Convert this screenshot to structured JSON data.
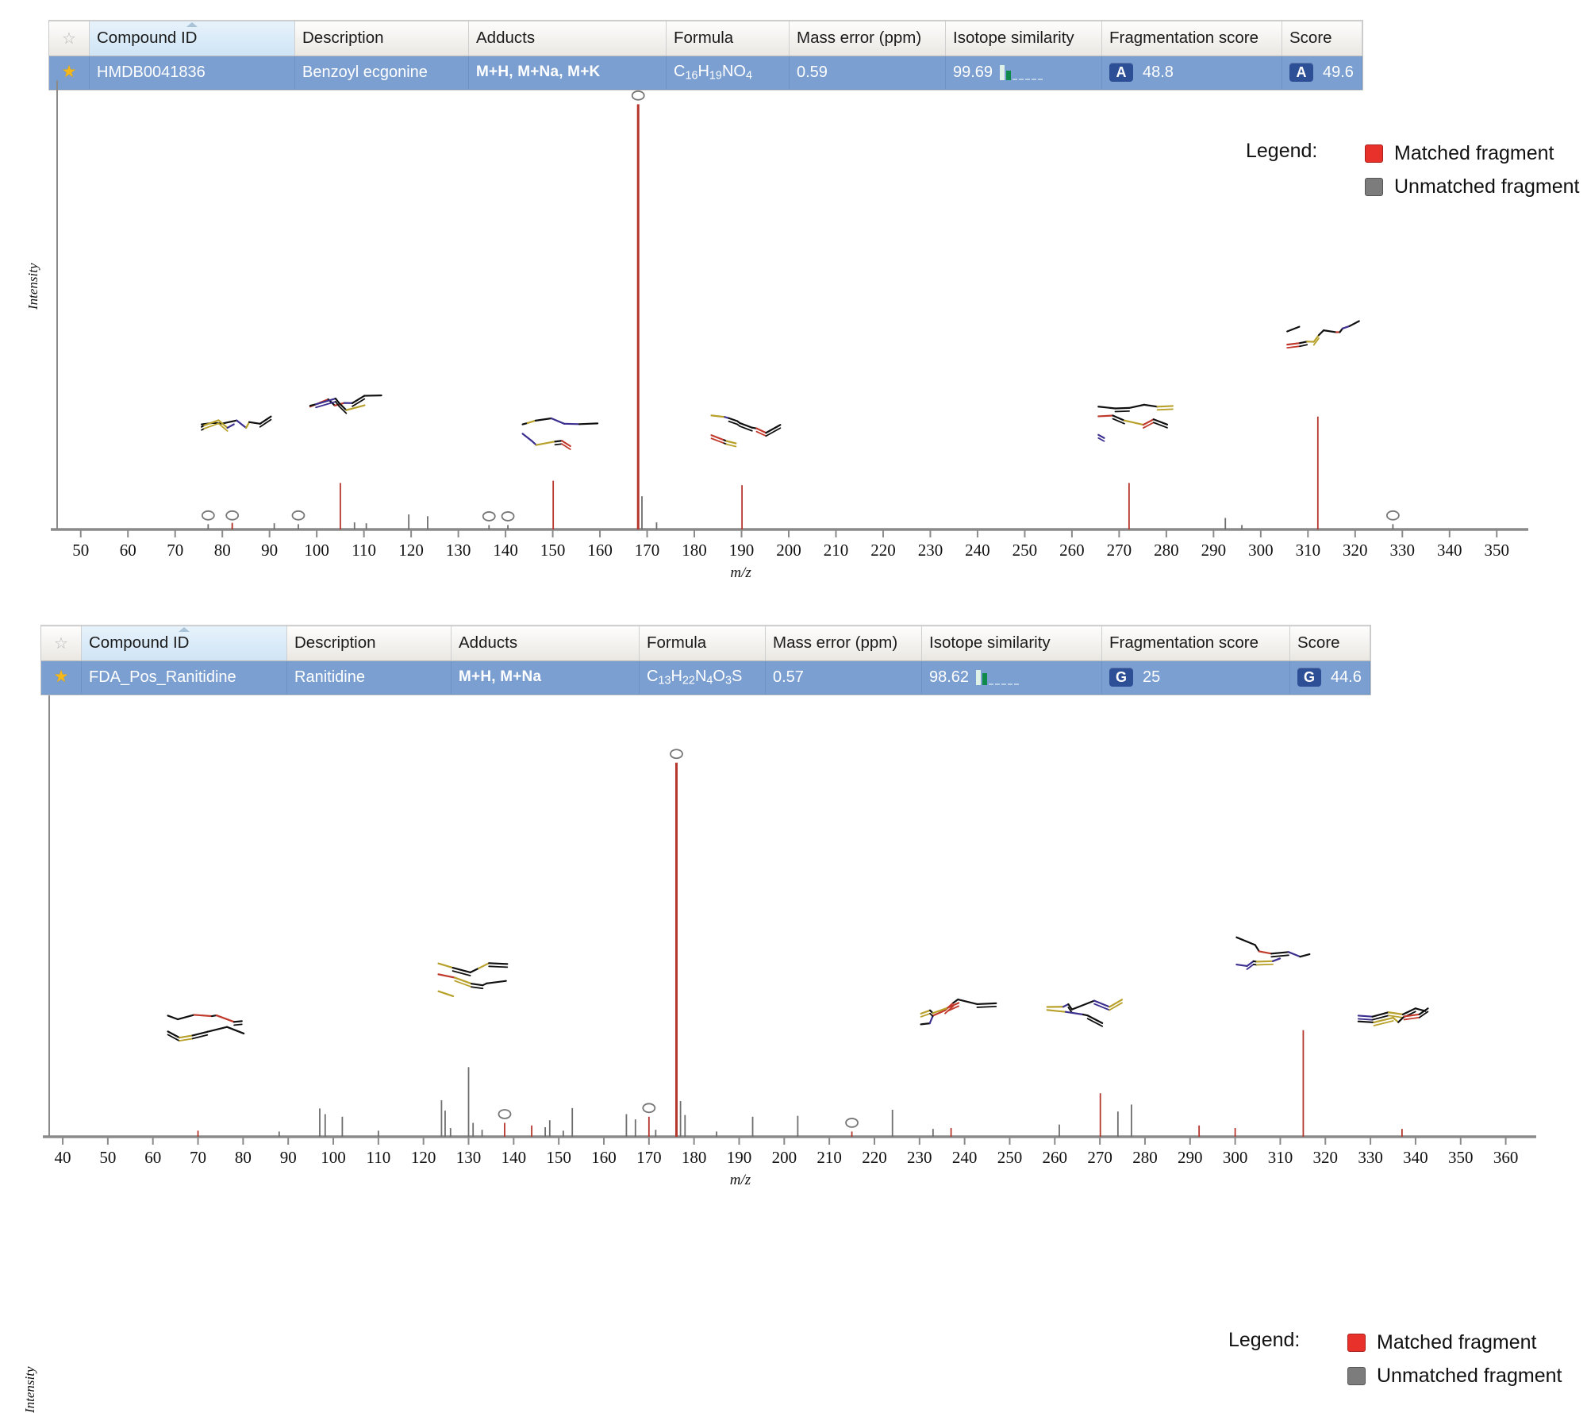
{
  "panels": [
    {
      "id": "panel-benzoylecgonine",
      "table": {
        "columns": [
          {
            "key": "star",
            "label": ""
          },
          {
            "key": "compound_id",
            "label": "Compound ID"
          },
          {
            "key": "description",
            "label": "Description"
          },
          {
            "key": "adducts",
            "label": "Adducts"
          },
          {
            "key": "formula",
            "label": "Formula"
          },
          {
            "key": "mass_error",
            "label": "Mass error (ppm)"
          },
          {
            "key": "isotope_similarity",
            "label": "Isotope similarity"
          },
          {
            "key": "fragmentation_score",
            "label": "Fragmentation score"
          },
          {
            "key": "score",
            "label": "Score"
          }
        ],
        "sorted_column": "Compound ID",
        "row": {
          "starred": true,
          "compound_id": "HMDB0041836",
          "description": "Benzoyl ecgonine",
          "adducts": "M+H, M+Na, M+K",
          "formula_html": "C<sub>16</sub>H<sub>19</sub>NO<sub>4</sub>",
          "formula_text": "C16H19NO4",
          "mass_error": "0.59",
          "isotope_similarity": "99.69",
          "isotope_bars": [
            100,
            62,
            12,
            7,
            6,
            5,
            4
          ],
          "fragmentation_grade": "A",
          "fragmentation_score": "48.8",
          "score_grade": "A",
          "score": "49.6"
        }
      },
      "legend": {
        "title": "Legend:",
        "items": [
          {
            "label": "Matched fragment",
            "color": "#e8312a"
          },
          {
            "label": "Unmatched fragment",
            "color": "#7c7c7c"
          }
        ]
      },
      "chart_data": {
        "type": "bar",
        "title": "",
        "xlabel": "m/z",
        "ylabel": "Intensity",
        "xlim": [
          45,
          355
        ],
        "ylim": [
          0,
          100
        ],
        "grid": false,
        "xticks": [
          50,
          60,
          70,
          80,
          90,
          100,
          110,
          120,
          130,
          140,
          150,
          160,
          170,
          180,
          190,
          200,
          210,
          220,
          230,
          240,
          250,
          260,
          270,
          280,
          290,
          300,
          310,
          320,
          330,
          340,
          350
        ],
        "series": [
          {
            "name": "Matched fragment",
            "color": "#b5362c",
            "points": [
              {
                "mz": 82.1,
                "intensity": 1.5
              },
              {
                "mz": 105.0,
                "intensity": 10.5
              },
              {
                "mz": 150.1,
                "intensity": 11.0
              },
              {
                "mz": 168.1,
                "intensity": 96.0,
                "annotated": true
              },
              {
                "mz": 190.1,
                "intensity": 10.0
              },
              {
                "mz": 272.1,
                "intensity": 10.5
              },
              {
                "mz": 312.1,
                "intensity": 25.5
              }
            ]
          },
          {
            "name": "Unmatched fragment",
            "color": "#6e6e6e",
            "points": [
              {
                "mz": 77.0,
                "intensity": 1.2,
                "annotated": true
              },
              {
                "mz": 82.1,
                "intensity": 1.2,
                "annotated": true
              },
              {
                "mz": 91.0,
                "intensity": 1.4
              },
              {
                "mz": 96.1,
                "intensity": 1.2,
                "annotated": true
              },
              {
                "mz": 108.0,
                "intensity": 1.6
              },
              {
                "mz": 110.5,
                "intensity": 1.4
              },
              {
                "mz": 119.5,
                "intensity": 3.4
              },
              {
                "mz": 123.5,
                "intensity": 3.0
              },
              {
                "mz": 136.5,
                "intensity": 1.0,
                "annotated": true
              },
              {
                "mz": 140.5,
                "intensity": 1.0,
                "annotated": true
              },
              {
                "mz": 168.9,
                "intensity": 7.5
              },
              {
                "mz": 172.0,
                "intensity": 1.6
              },
              {
                "mz": 292.5,
                "intensity": 2.6
              },
              {
                "mz": 296.0,
                "intensity": 1.0
              },
              {
                "mz": 328.0,
                "intensity": 1.2,
                "annotated": true
              }
            ]
          }
        ],
        "structures": [
          {
            "mz": 82,
            "label": "fragment-structure-82"
          },
          {
            "mz": 105,
            "label": "fragment-structure-105"
          },
          {
            "mz": 150,
            "label": "fragment-structure-150"
          },
          {
            "mz": 190,
            "label": "fragment-structure-190"
          },
          {
            "mz": 272,
            "label": "fragment-structure-272"
          },
          {
            "mz": 312,
            "label": "fragment-structure-312"
          }
        ]
      }
    },
    {
      "id": "panel-ranitidine",
      "table": {
        "columns": [
          {
            "key": "star",
            "label": ""
          },
          {
            "key": "compound_id",
            "label": "Compound ID"
          },
          {
            "key": "description",
            "label": "Description"
          },
          {
            "key": "adducts",
            "label": "Adducts"
          },
          {
            "key": "formula",
            "label": "Formula"
          },
          {
            "key": "mass_error",
            "label": "Mass error (ppm)"
          },
          {
            "key": "isotope_similarity",
            "label": "Isotope similarity"
          },
          {
            "key": "fragmentation_score",
            "label": "Fragmentation score"
          },
          {
            "key": "score",
            "label": "Score"
          }
        ],
        "sorted_column": "Compound ID",
        "row": {
          "starred": true,
          "compound_id": "FDA_Pos_Ranitidine",
          "description": "Ranitidine",
          "adducts": "M+H, M+Na",
          "formula_html": "C<sub>13</sub>H<sub>22</sub>N<sub>4</sub>O<sub>3</sub>S",
          "formula_text": "C13H22N4O3S",
          "mass_error": "0.57",
          "isotope_similarity": "98.62",
          "isotope_bars": [
            100,
            78,
            20,
            10,
            8,
            6,
            6
          ],
          "fragmentation_grade": "G",
          "fragmentation_score": "25",
          "score_grade": "G",
          "score": "44.6"
        }
      },
      "legend": {
        "title": "Legend:",
        "items": [
          {
            "label": "Matched fragment",
            "color": "#e8312a"
          },
          {
            "label": "Unmatched fragment",
            "color": "#7c7c7c"
          }
        ]
      },
      "chart_data": {
        "type": "bar",
        "title": "",
        "xlabel": "m/z",
        "ylabel": "Intensity",
        "xlim": [
          37,
          365
        ],
        "ylim": [
          0,
          100
        ],
        "grid": false,
        "xticks": [
          40,
          50,
          60,
          70,
          80,
          90,
          100,
          110,
          120,
          130,
          140,
          150,
          160,
          170,
          180,
          190,
          200,
          210,
          220,
          230,
          240,
          250,
          260,
          270,
          280,
          290,
          300,
          310,
          320,
          330,
          340,
          350,
          360
        ],
        "series": [
          {
            "name": "Matched fragment",
            "color": "#b5362c",
            "points": [
              {
                "mz": 70.0,
                "intensity": 1.4
              },
              {
                "mz": 138.0,
                "intensity": 3.2,
                "annotated": true
              },
              {
                "mz": 144.0,
                "intensity": 2.6
              },
              {
                "mz": 170.0,
                "intensity": 4.6,
                "annotated": true
              },
              {
                "mz": 176.1,
                "intensity": 86.0,
                "annotated": true
              },
              {
                "mz": 215.0,
                "intensity": 1.2,
                "annotated": true
              },
              {
                "mz": 237.0,
                "intensity": 2.0
              },
              {
                "mz": 270.1,
                "intensity": 10.0
              },
              {
                "mz": 292.0,
                "intensity": 2.6
              },
              {
                "mz": 300.0,
                "intensity": 2.0
              },
              {
                "mz": 315.1,
                "intensity": 24.5
              },
              {
                "mz": 337.0,
                "intensity": 1.8
              }
            ]
          },
          {
            "name": "Unmatched fragment",
            "color": "#6e6e6e",
            "points": [
              {
                "mz": 88.0,
                "intensity": 1.2
              },
              {
                "mz": 97.0,
                "intensity": 6.5
              },
              {
                "mz": 98.2,
                "intensity": 5.2
              },
              {
                "mz": 102.0,
                "intensity": 4.6
              },
              {
                "mz": 110.0,
                "intensity": 1.4
              },
              {
                "mz": 124.0,
                "intensity": 8.4
              },
              {
                "mz": 124.8,
                "intensity": 6.0
              },
              {
                "mz": 126.0,
                "intensity": 2.0
              },
              {
                "mz": 130.0,
                "intensity": 16.0
              },
              {
                "mz": 131.0,
                "intensity": 3.2
              },
              {
                "mz": 133.0,
                "intensity": 1.6
              },
              {
                "mz": 147.0,
                "intensity": 2.2
              },
              {
                "mz": 148.0,
                "intensity": 3.8
              },
              {
                "mz": 151.0,
                "intensity": 1.4
              },
              {
                "mz": 153.0,
                "intensity": 6.6
              },
              {
                "mz": 165.0,
                "intensity": 5.2
              },
              {
                "mz": 167.0,
                "intensity": 4.0
              },
              {
                "mz": 171.5,
                "intensity": 1.6
              },
              {
                "mz": 177.0,
                "intensity": 8.2
              },
              {
                "mz": 178.0,
                "intensity": 5.0
              },
              {
                "mz": 185.0,
                "intensity": 1.2
              },
              {
                "mz": 193.0,
                "intensity": 4.6
              },
              {
                "mz": 203.0,
                "intensity": 4.8
              },
              {
                "mz": 224.0,
                "intensity": 6.2
              },
              {
                "mz": 233.0,
                "intensity": 1.8
              },
              {
                "mz": 261.0,
                "intensity": 2.8
              },
              {
                "mz": 274.0,
                "intensity": 5.8
              },
              {
                "mz": 277.0,
                "intensity": 7.4
              }
            ]
          }
        ],
        "structures": [
          {
            "mz": 70,
            "label": "fragment-structure-70"
          },
          {
            "mz": 130,
            "label": "fragment-structure-130"
          },
          {
            "mz": 237,
            "label": "fragment-structure-237"
          },
          {
            "mz": 265,
            "label": "fragment-structure-265"
          },
          {
            "mz": 307,
            "label": "fragment-structure-307"
          },
          {
            "mz": 334,
            "label": "fragment-structure-334"
          }
        ]
      }
    }
  ]
}
